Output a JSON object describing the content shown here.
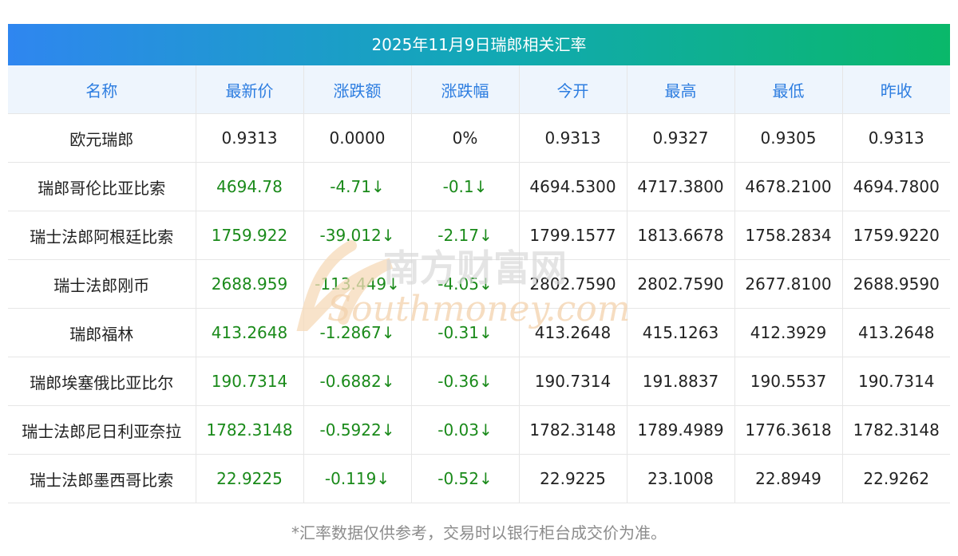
{
  "title": "2025年11月9日瑞郎相关汇率",
  "headers": [
    "名称",
    "最新价",
    "涨跌额",
    "涨跌幅",
    "今开",
    "最高",
    "最低",
    "昨收"
  ],
  "rows": [
    {
      "name": "欧元瑞郎",
      "latest": "0.9313",
      "change": "0.0000",
      "pct": "0%",
      "open": "0.9313",
      "high": "0.9327",
      "low": "0.9305",
      "prev": "0.9313"
    },
    {
      "name": "瑞郎哥伦比亚比索",
      "latest": "4694.78",
      "change": "-4.71↓",
      "pct": "-0.1↓",
      "open": "4694.5300",
      "high": "4717.3800",
      "low": "4678.2100",
      "prev": "4694.7800"
    },
    {
      "name": "瑞士法郎阿根廷比索",
      "latest": "1759.922",
      "change": "-39.012↓",
      "pct": "-2.17↓",
      "open": "1799.1577",
      "high": "1813.6678",
      "low": "1758.2834",
      "prev": "1759.9220"
    },
    {
      "name": "瑞士法郎刚币",
      "latest": "2688.959",
      "change": "-113.449↓",
      "pct": "-4.05↓",
      "open": "2802.7590",
      "high": "2802.7590",
      "low": "2677.8100",
      "prev": "2688.9590"
    },
    {
      "name": "瑞郎福林",
      "latest": "413.2648",
      "change": "-1.2867↓",
      "pct": "-0.31↓",
      "open": "413.2648",
      "high": "415.1263",
      "low": "412.3929",
      "prev": "413.2648"
    },
    {
      "name": "瑞郎埃塞俄比亚比尔",
      "latest": "190.7314",
      "change": "-0.6882↓",
      "pct": "-0.36↓",
      "open": "190.7314",
      "high": "191.8837",
      "low": "190.5537",
      "prev": "190.7314"
    },
    {
      "name": "瑞士法郎尼日利亚奈拉",
      "latest": "1782.3148",
      "change": "-0.5922↓",
      "pct": "-0.03↓",
      "open": "1782.3148",
      "high": "1789.4989",
      "low": "1776.3618",
      "prev": "1782.3148"
    },
    {
      "name": "瑞士法郎墨西哥比索",
      "latest": "22.9225",
      "change": "-0.119↓",
      "pct": "-0.52↓",
      "open": "22.9225",
      "high": "23.1008",
      "low": "22.8949",
      "prev": "22.9262"
    }
  ],
  "watermark": {
    "cn": "南方财富网",
    "en": "Southmoney.com"
  },
  "note": "*汇率数据仅供参考，交易时以银行柜台成交价为准。",
  "colors": {
    "header_text": "#2d7de0",
    "header_bg": "#eef5fd",
    "down": "#1a8a1a",
    "title_from": "#2f86f0",
    "title_to": "#0ab86a"
  }
}
